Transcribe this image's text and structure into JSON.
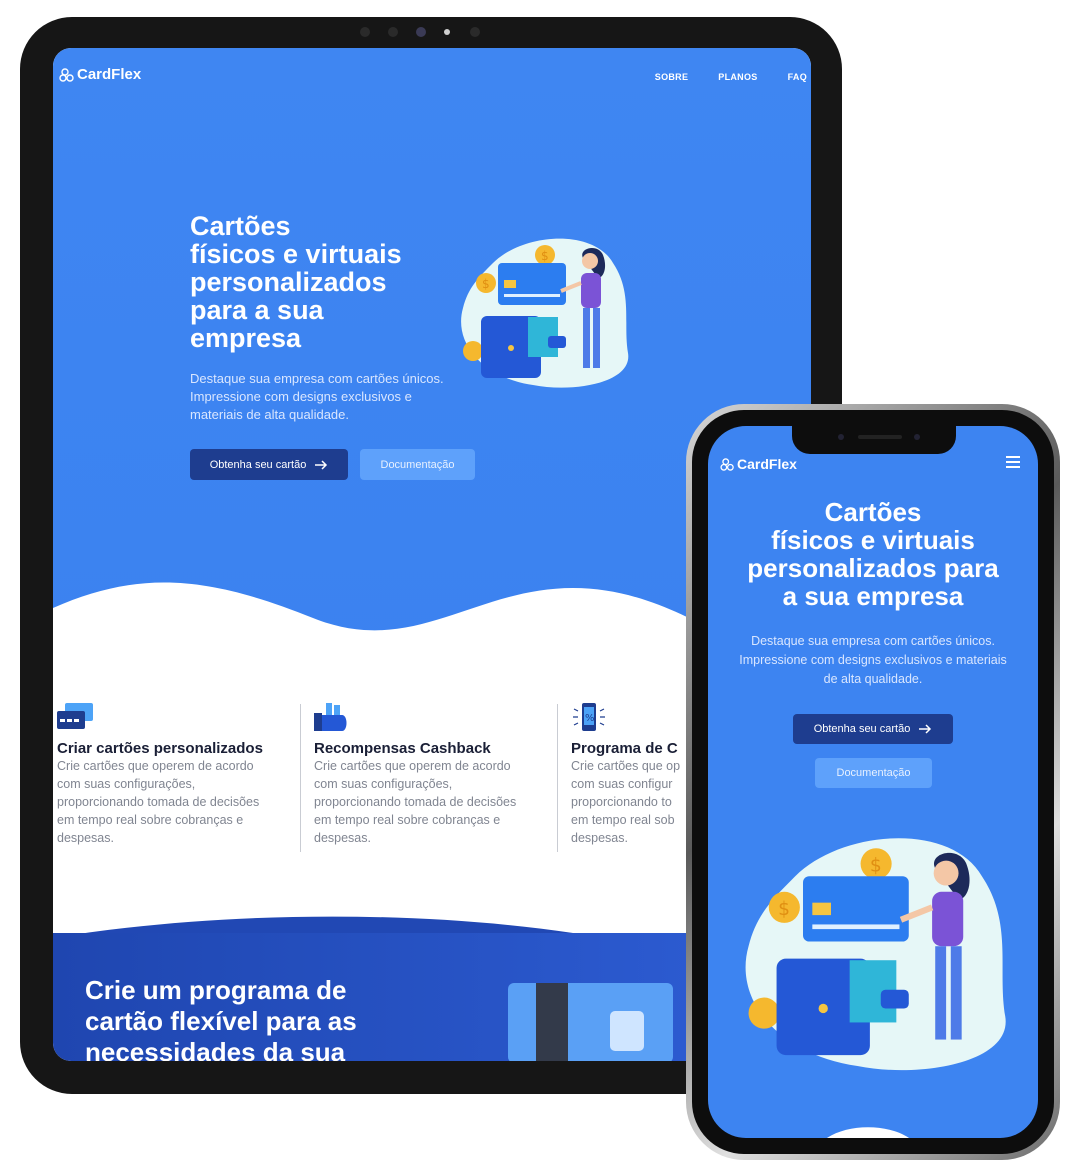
{
  "brand": {
    "name": "CardFlex"
  },
  "tablet": {
    "nav": [
      "SOBRE",
      "PLANOS",
      "FAQ"
    ],
    "hero": {
      "title_lines": [
        "Cartões",
        "físicos e virtuais",
        "personalizados",
        "para a sua",
        "empresa"
      ],
      "description_lines": [
        "Destaque sua empresa com cartões únicos.",
        "Impressione com designs exclusivos e",
        "materiais de alta qualidade."
      ],
      "primary_button": "Obtenha seu cartão",
      "secondary_button": "Documentação"
    },
    "features": [
      {
        "icon": "card-icon",
        "title": "Criar cartões personalizados",
        "text_lines": [
          "Crie cartões que operem de acordo",
          "com suas configurações,",
          "proporcionando tomada de decisões",
          "em tempo real sobre cobranças e",
          "despesas."
        ]
      },
      {
        "icon": "cashback-icon",
        "title": "Recompensas Cashback",
        "text_lines": [
          "Crie cartões que operem de acordo",
          "com suas configurações,",
          "proporcionando tomada de decisões",
          "em tempo real sobre cobranças e",
          "despesas."
        ]
      },
      {
        "icon": "discount-phone-icon",
        "title": "Programa de C",
        "text_lines": [
          "Crie cartões que op",
          "com suas configur",
          "proporcionando to",
          "em tempo real sob",
          "despesas."
        ]
      }
    ],
    "bottom": {
      "title_lines": [
        "Crie um programa de",
        "cartão flexível para as",
        "necessidades da sua"
      ]
    }
  },
  "phone": {
    "hero": {
      "title_lines": [
        "Cartões",
        "físicos e virtuais",
        "personalizados para",
        "a sua empresa"
      ],
      "description_lines": [
        "Destaque sua empresa com cartões únicos.",
        "Impressione com designs exclusivos e materiais",
        "de alta qualidade."
      ],
      "primary_button": "Obtenha seu cartão",
      "secondary_button": "Documentação"
    }
  },
  "colors": {
    "primary": "#3b82f0",
    "dark_button": "#1e3d8f",
    "light_button": "#5ea1fb"
  }
}
